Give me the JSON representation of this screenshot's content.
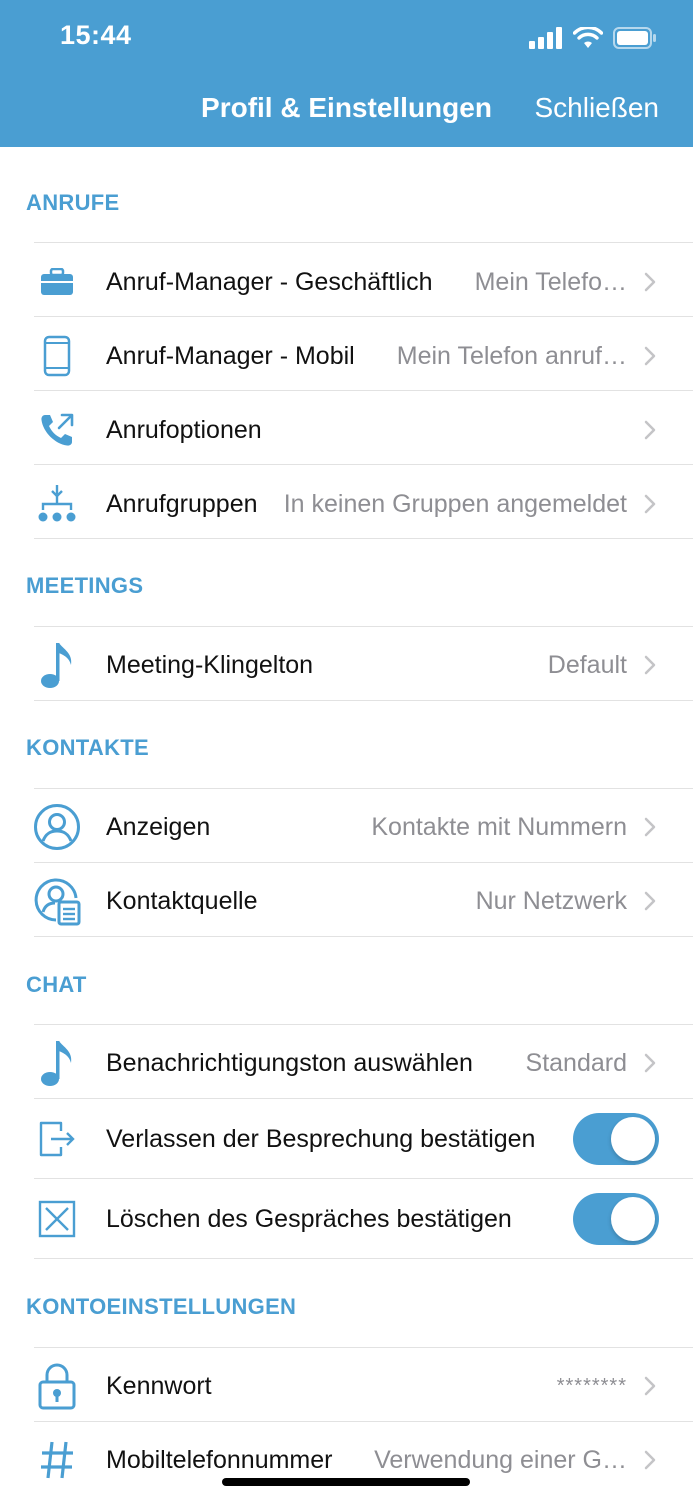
{
  "status_bar": {
    "time": "15:44"
  },
  "nav": {
    "title": "Profil & Einstellungen",
    "close_label": "Schließen"
  },
  "colors": {
    "accent": "#4A9ED2",
    "secondary_text": "#8e8e93"
  },
  "sections": {
    "anrufe": {
      "title": "ANRUFE",
      "items": [
        {
          "icon": "briefcase-icon",
          "label": "Anruf-Manager - Geschäftlich",
          "value": "Mein Telefo…"
        },
        {
          "icon": "mobile-phone-icon",
          "label": "Anruf-Manager - Mobil",
          "value": "Mein Telefon anruf…"
        },
        {
          "icon": "call-forward-icon",
          "label": "Anrufoptionen",
          "value": ""
        },
        {
          "icon": "call-group-icon",
          "label": "Anrufgruppen",
          "value": "In keinen Gruppen angemeldet"
        }
      ]
    },
    "meetings": {
      "title": "MEETINGS",
      "items": [
        {
          "icon": "music-note-icon",
          "label": "Meeting-Klingelton",
          "value": "Default"
        }
      ]
    },
    "kontakte": {
      "title": "KONTAKTE",
      "items": [
        {
          "icon": "user-circle-icon",
          "label": "Anzeigen",
          "value": "Kontakte mit Nummern"
        },
        {
          "icon": "contact-source-icon",
          "label": "Kontaktquelle",
          "value": "Nur Netzwerk"
        }
      ]
    },
    "chat": {
      "title": "CHAT",
      "items": [
        {
          "icon": "music-note-icon",
          "label": "Benachrichtigungston auswählen",
          "value": "Standard"
        },
        {
          "icon": "exit-icon",
          "label": "Verlassen der Besprechung bestätigen",
          "toggle": true
        },
        {
          "icon": "delete-box-icon",
          "label": "Löschen des Gespräches bestätigen",
          "toggle": true
        }
      ]
    },
    "konto": {
      "title": "KONTOEINSTELLUNGEN",
      "items": [
        {
          "icon": "lock-icon",
          "label": "Kennwort",
          "value": "********"
        },
        {
          "icon": "hash-icon",
          "label": "Mobiltelefonnummer",
          "value": "Verwendung einer G…"
        }
      ]
    }
  }
}
